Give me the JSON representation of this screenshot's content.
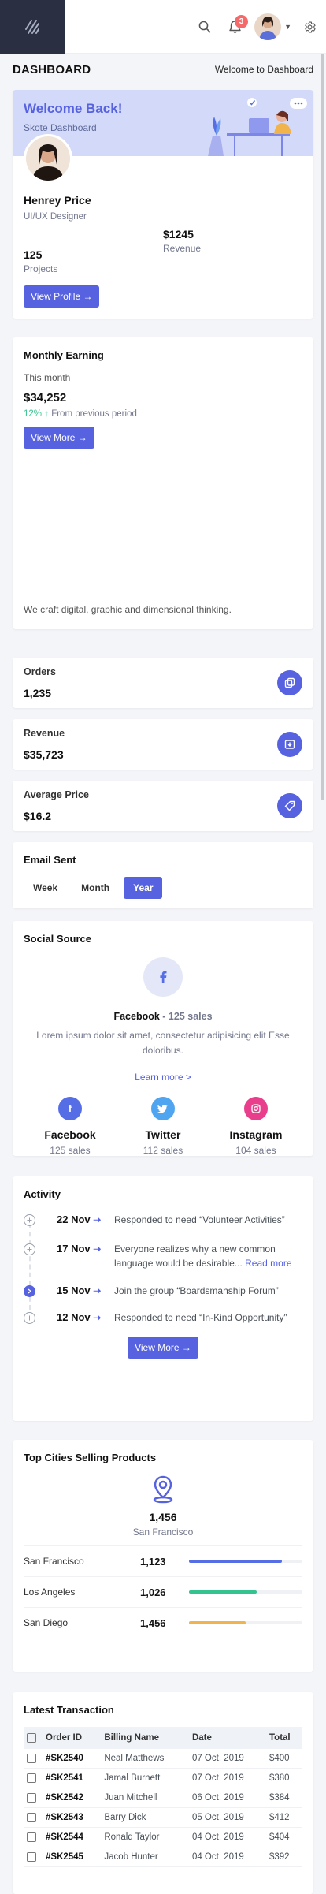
{
  "header": {
    "notification_count": "3",
    "logo_icon": "brand-logo-icon",
    "search_icon": "search-icon",
    "bell_icon": "bell-icon",
    "settings_icon": "gear-icon"
  },
  "page": {
    "title": "DASHBOARD",
    "breadcrumb": "Welcome to Dashboard"
  },
  "welcome": {
    "title": "Welcome Back!",
    "subtitle": "Skote Dashboard",
    "name": "Henrey Price",
    "role": "UI/UX Designer",
    "projects_value": "125",
    "projects_label": "Projects",
    "revenue_value": "$1245",
    "revenue_label": "Revenue",
    "button": "View Profile →"
  },
  "earning": {
    "title": "Monthly Earning",
    "period": "This month",
    "value": "$34,252",
    "trend_value": "12%",
    "trend_arrow": "↑",
    "trend_text": "From previous period",
    "button": "View More →",
    "footer": "We craft digital, graphic and dimensional thinking."
  },
  "mini_stats": [
    {
      "label": "Orders",
      "value": "1,235",
      "icon": "copy-icon"
    },
    {
      "label": "Revenue",
      "value": "$35,723",
      "icon": "archive-in-icon"
    },
    {
      "label": "Average Price",
      "value": "$16.2",
      "icon": "tag-icon"
    }
  ],
  "email": {
    "title": "Email Sent",
    "tabs": [
      "Week",
      "Month",
      "Year"
    ],
    "active_tab": "Year"
  },
  "social": {
    "title": "Social Source",
    "headline_name": "Facebook",
    "headline_sales": " - 125 sales",
    "description": "Lorem ipsum dolor sit amet, consectetur adipisicing elit Esse doloribus.",
    "link": "Learn more >",
    "sources": [
      {
        "name": "Facebook",
        "sales": "125 sales",
        "color": "#556ee6",
        "icon": "facebook-icon"
      },
      {
        "name": "Twitter",
        "sales": "112 sales",
        "color": "#50a5f1",
        "icon": "twitter-icon"
      },
      {
        "name": "Instagram",
        "sales": "104 sales",
        "color": "#f46aa0",
        "icon": "instagram-icon"
      }
    ]
  },
  "activity": {
    "title": "Activity",
    "items": [
      {
        "date": "22 Nov",
        "text": "Responded to need “Volunteer Activities”",
        "link": ""
      },
      {
        "date": "17 Nov",
        "text": "Everyone realizes why a new common language would be desirable... ",
        "link": "Read more"
      },
      {
        "date": "15 Nov",
        "text": "Join the group “Boardsmanship Forum”",
        "link": ""
      },
      {
        "date": "12 Nov",
        "text": "Responded to need “In-Kind Opportunity”",
        "link": ""
      }
    ],
    "button": "View More →"
  },
  "cities": {
    "title": "Top Cities Selling Products",
    "total": "1,456",
    "total_city": "San Francisco",
    "rows": [
      {
        "name": "San Francisco",
        "value": "1,123",
        "fill": 0.82,
        "color": "#556ee6"
      },
      {
        "name": "Los Angeles",
        "value": "1,026",
        "fill": 0.6,
        "color": "#34c38f"
      },
      {
        "name": "San Diego",
        "value": "1,456",
        "fill": 0.5,
        "color": "#f1b44c"
      }
    ]
  },
  "transactions": {
    "title": "Latest Transaction",
    "columns": [
      "Order ID",
      "Billing Name",
      "Date",
      "Total"
    ],
    "rows": [
      {
        "id": "#SK2540",
        "name": "Neal Matthews",
        "date": "07 Oct, 2019",
        "total": "$400"
      },
      {
        "id": "#SK2541",
        "name": "Jamal Burnett",
        "date": "07 Oct, 2019",
        "total": "$380"
      },
      {
        "id": "#SK2542",
        "name": "Juan Mitchell",
        "date": "06 Oct, 2019",
        "total": "$384"
      },
      {
        "id": "#SK2543",
        "name": "Barry Dick",
        "date": "05 Oct, 2019",
        "total": "$412"
      },
      {
        "id": "#SK2544",
        "name": "Ronald Taylor",
        "date": "04 Oct, 2019",
        "total": "$404"
      },
      {
        "id": "#SK2545",
        "name": "Jacob Hunter",
        "date": "04 Oct, 2019",
        "total": "$392"
      }
    ]
  }
}
